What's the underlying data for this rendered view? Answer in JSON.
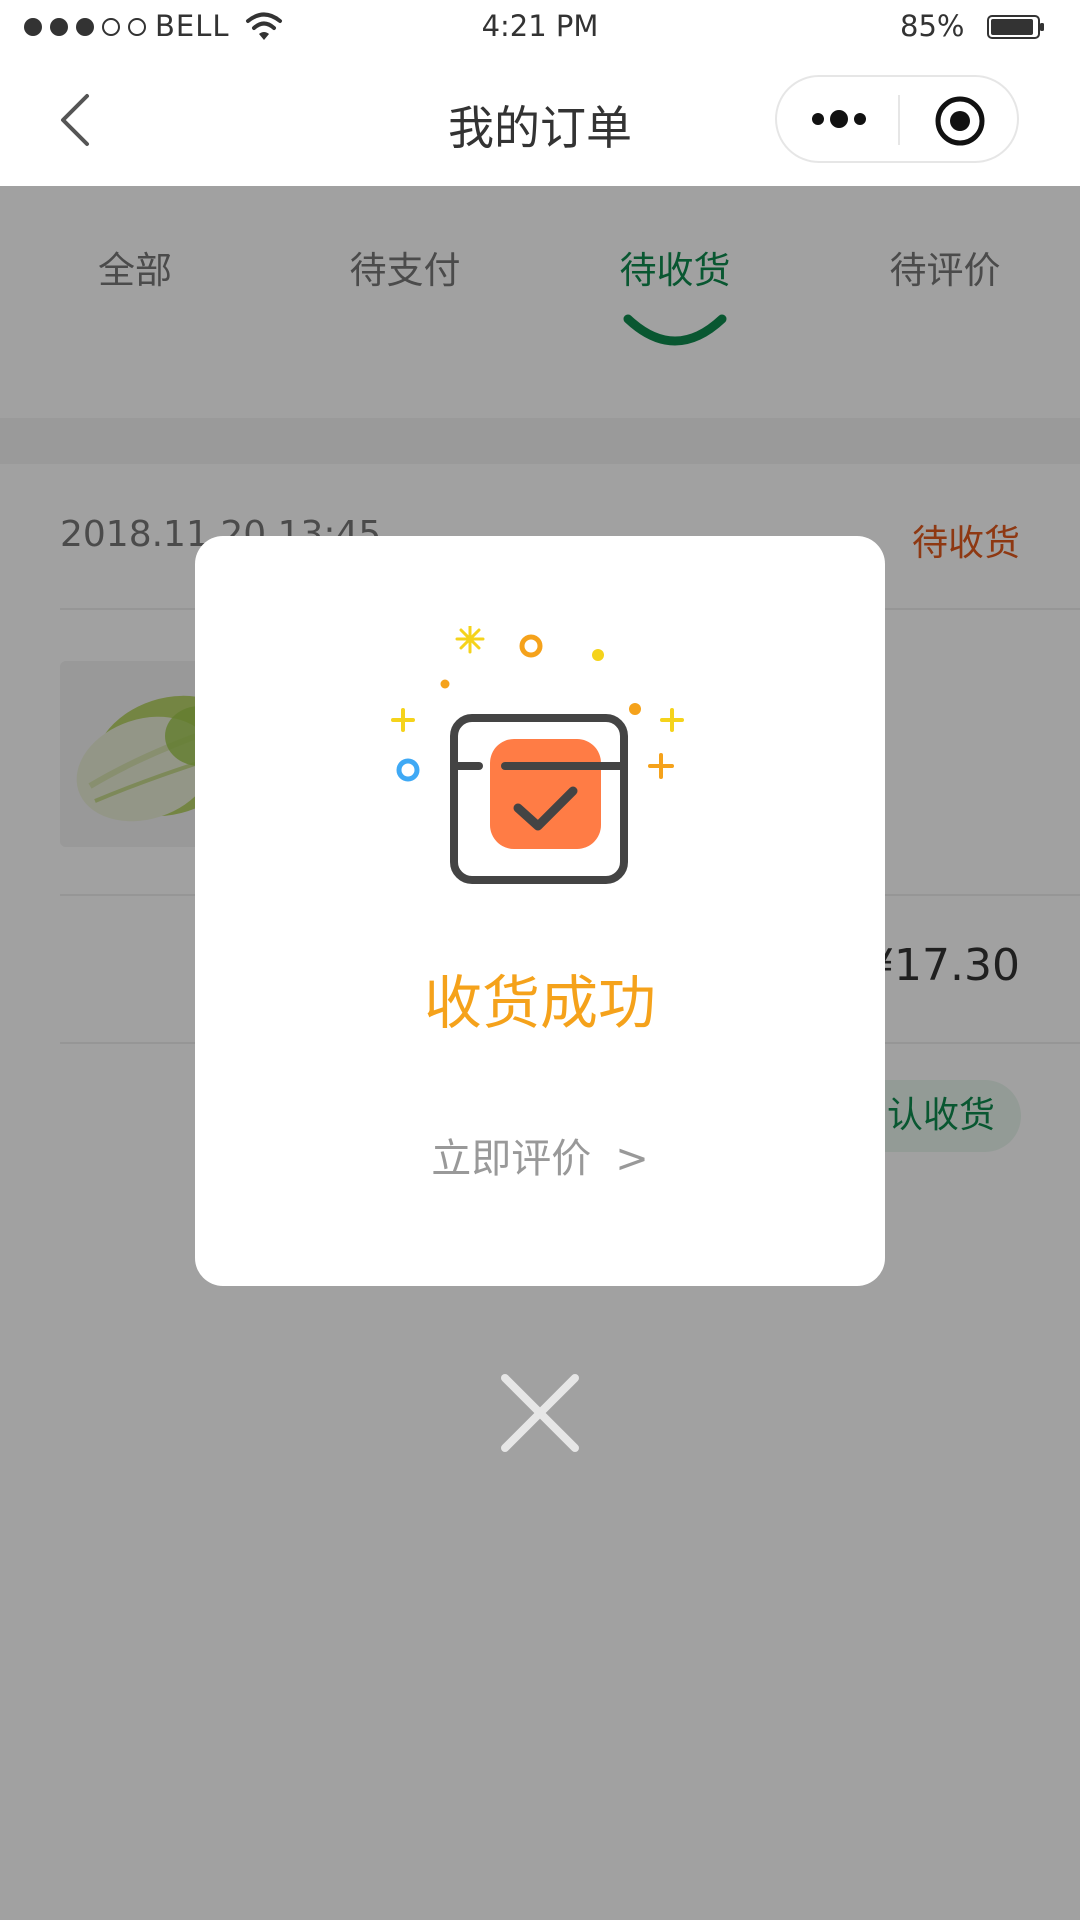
{
  "status_bar": {
    "carrier": "BELL",
    "time": "4:21 PM",
    "battery": "85%",
    "signal_bars_filled": 3,
    "signal_bars_total": 5,
    "battery_level": 0.85
  },
  "nav": {
    "title": "我的订单",
    "back_icon": "chevron-left-icon",
    "more_icon": "more-dots-icon",
    "close_app_icon": "target-icon"
  },
  "tabs": {
    "items": [
      {
        "label": "全部"
      },
      {
        "label": "待支付"
      },
      {
        "label": "待收货"
      },
      {
        "label": "待评价"
      }
    ],
    "active_index": 2
  },
  "order": {
    "datetime": "2018.11.20 13:45",
    "status": "待收货",
    "product_image": "napa-cabbage",
    "price": "¥17.30",
    "action_label": "确认收货"
  },
  "dialog": {
    "icon": "box-check-icon",
    "title": "收货成功",
    "link_label": "立即评价",
    "link_arrow": ">",
    "close_icon": "close-icon"
  },
  "colors": {
    "accent_green": "#0f8a4f",
    "status_orange": "#e15a1e",
    "success_yellow": "#f5a21b",
    "icon_orange": "#ff7c45"
  }
}
